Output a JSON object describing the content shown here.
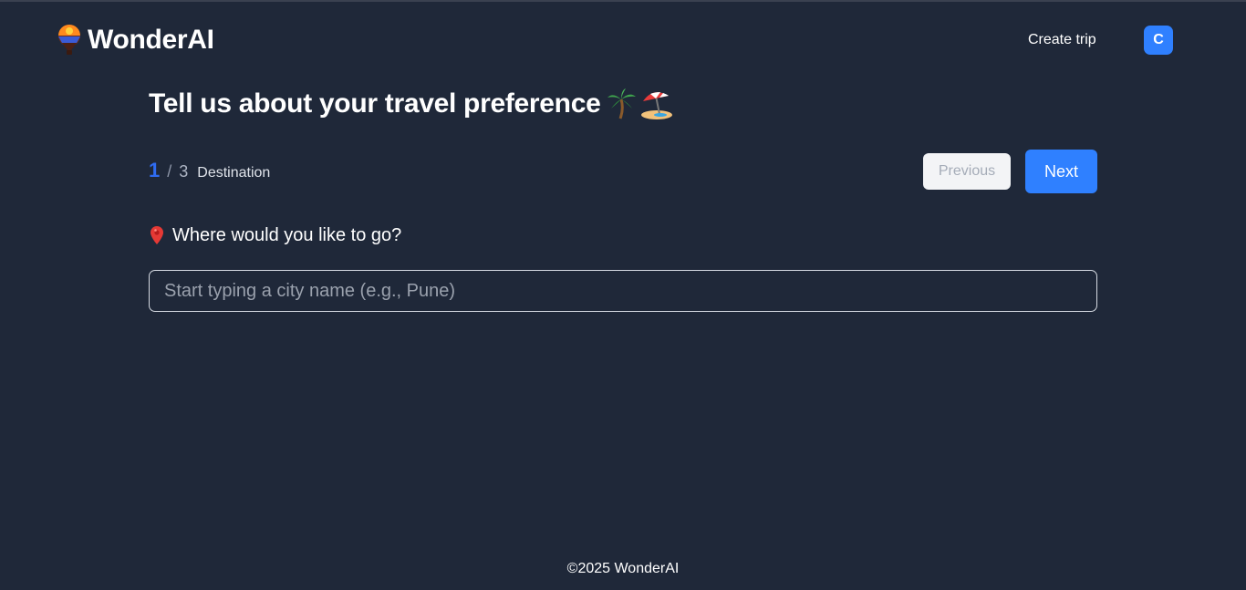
{
  "app": {
    "name": "WonderAI",
    "logo_icon": "hot-air-balloon-icon"
  },
  "nav": {
    "create_trip": "Create trip",
    "avatar_initial": "C",
    "avatar_color": "#2f80ff"
  },
  "page": {
    "title": "Tell us about your travel preference",
    "title_icons": [
      "palm-tree-icon",
      "beach-umbrella-icon"
    ]
  },
  "steps": {
    "current": "1",
    "separator": "/",
    "total": "3",
    "label": "Destination"
  },
  "buttons": {
    "previous": "Previous",
    "next": "Next",
    "accent_color": "#2f80ff"
  },
  "question": {
    "icon": "map-pin-icon",
    "text": "Where would you like to go?"
  },
  "search": {
    "value": "",
    "placeholder": "Start typing a city name (e.g., Pune)"
  },
  "footer": {
    "copyright": "©2025 WonderAI"
  },
  "theme": {
    "background": "#1f2839",
    "step_current_color": "#2f6cf2"
  }
}
